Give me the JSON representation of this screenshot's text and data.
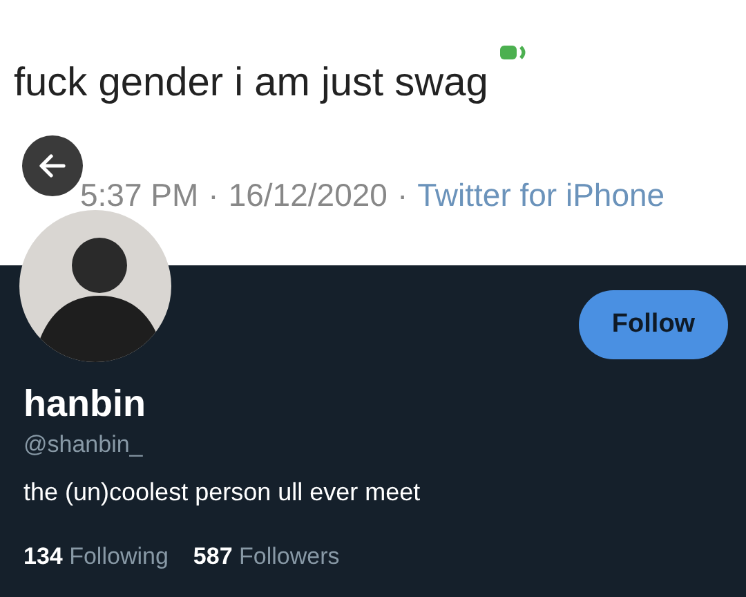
{
  "header_tweet": {
    "text": "fuck gender i am just swag",
    "time": "5:37 PM",
    "date": "16/12/2020",
    "source": "Twitter for iPhone",
    "separators": [
      "·",
      "·"
    ]
  },
  "profile": {
    "name": "hanbin",
    "handle": "@shanbin_",
    "bio": "the (un)coolest person ull ever meet"
  },
  "follow_button": {
    "label": "Follow"
  },
  "stats": [
    {
      "count": "134",
      "label": "Following"
    },
    {
      "count": "587",
      "label": "Followers"
    }
  ]
}
